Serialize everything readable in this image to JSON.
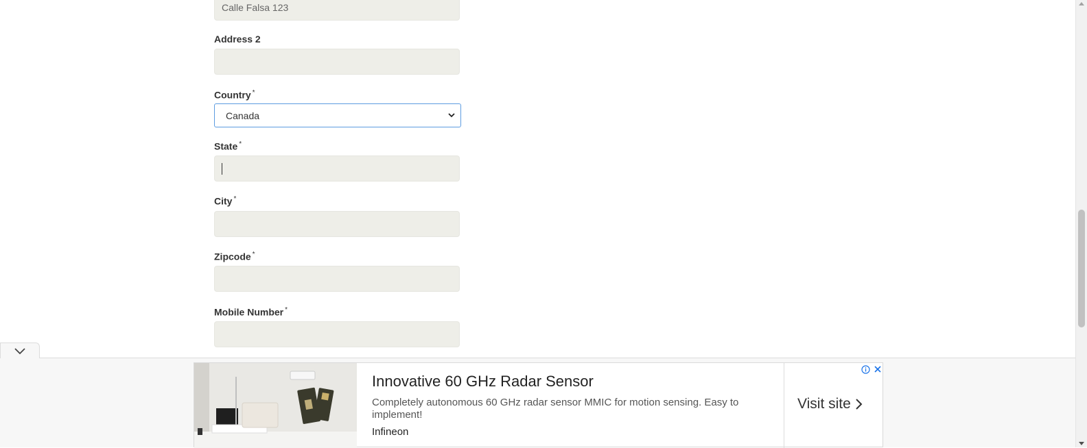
{
  "form": {
    "address1_value": "Calle Falsa 123",
    "address2_label": "Address 2",
    "address2_value": "",
    "country_label": "Country",
    "country_selected": "Canada",
    "state_label": "State",
    "state_value": "",
    "city_label": "City",
    "city_value": "",
    "zipcode_label": "Zipcode",
    "zipcode_value": "",
    "mobile_label": "Mobile Number",
    "mobile_value": "",
    "required_mark": "*"
  },
  "ad": {
    "title": "Innovative 60 GHz Radar Sensor",
    "description": "Completely autonomous 60 GHz radar sensor MMIC for motion sensing. Easy to implement!",
    "brand": "Infineon",
    "cta": "Visit site"
  },
  "colors": {
    "input_bg": "#eeeee8",
    "select_border": "#5b9be0",
    "ad_info": "#1a73e8"
  }
}
